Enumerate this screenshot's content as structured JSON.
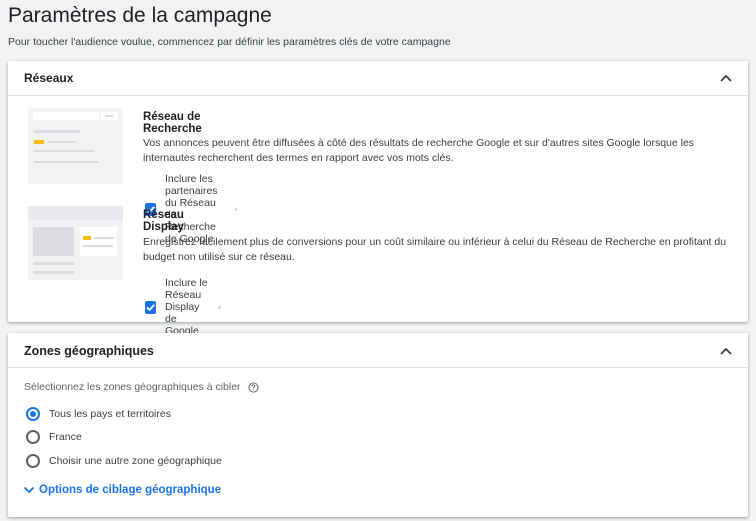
{
  "page": {
    "title": "Paramètres de la campagne",
    "subtitle": "Pour toucher l'audience voulue, commencez par définir les paramètres clés de votre campagne"
  },
  "networks": {
    "title": "Réseaux",
    "search": {
      "name": "Réseau de Recherche",
      "description": "Vos annonces peuvent être diffusées à côté des résultats de recherche Google et sur d'autres sites Google lorsque les internautes recherchent des termes en rapport avec vos mots clés.",
      "checkbox_label": "Inclure les partenaires du Réseau de Recherche de Google",
      "checked": true
    },
    "display": {
      "name": "Réseau Display",
      "description": "Enregistrez facilement plus de conversions pour un coût similaire ou inférieur à celui du Réseau de Recherche en profitant du budget non utilisé sur ce réseau.",
      "checkbox_label": "Inclure le Réseau Display de Google",
      "checked": true
    }
  },
  "geo": {
    "title": "Zones géographiques",
    "label": "Sélectionnez les zones géographiques à cibler",
    "options": [
      {
        "label": "Tous les pays et territoires",
        "checked": true
      },
      {
        "label": "France",
        "checked": false
      },
      {
        "label": "Choisir une autre zone géographique",
        "checked": false
      }
    ],
    "more_options": "Options de ciblage géographique"
  },
  "colors": {
    "accent": "#1a73e8",
    "illustration_yellow": "#fbbc04"
  }
}
